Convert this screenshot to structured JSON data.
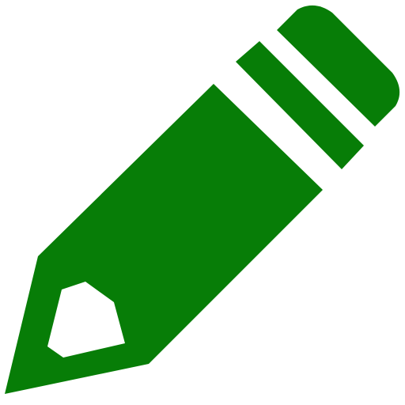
{
  "icon": {
    "name": "pencil-icon",
    "color": "#077D07",
    "background": "#FFFFFF"
  }
}
